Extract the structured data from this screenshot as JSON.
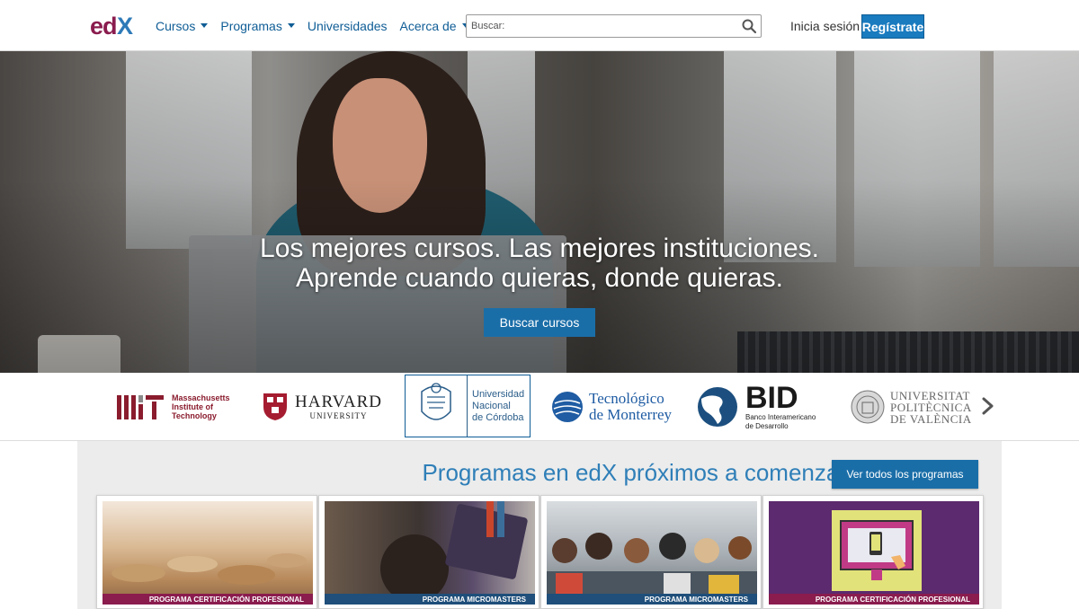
{
  "header": {
    "logo_text": "edX",
    "nav": [
      {
        "label": "Cursos",
        "has_caret": true
      },
      {
        "label": "Programas",
        "has_caret": true
      },
      {
        "label": "Universidades",
        "has_caret": false
      },
      {
        "label": "Acerca de",
        "has_caret": true
      }
    ],
    "search_placeholder": "Buscar:",
    "signin_label": "Inicia sesión",
    "register_label": "Regístrate"
  },
  "hero": {
    "title_line1": "Los mejores cursos. Las mejores instituciones.",
    "title_line2": "Aprende cuando quieras, donde quieras.",
    "cta_label": "Buscar cursos"
  },
  "partners": [
    {
      "name": "Massachusetts Institute of Technology",
      "lines": [
        "Massachusetts",
        "Institute of",
        "Technology"
      ]
    },
    {
      "name": "Harvard University",
      "lines": [
        "HARVARD",
        "UNIVERSITY"
      ]
    },
    {
      "name": "Universidad Nacional de Córdoba",
      "lines": [
        "Universidad",
        "Nacional",
        "de Córdoba"
      ]
    },
    {
      "name": "Tecnológico de Monterrey",
      "lines": [
        "Tecnológico",
        "de Monterrey"
      ]
    },
    {
      "name": "BID",
      "lines": [
        "BID",
        "Banco Interamericano",
        "de Desarrollo"
      ]
    },
    {
      "name": "Universitat Politècnica de València",
      "lines": [
        "UNIVERSITAT",
        "POLITÈCNICA",
        "DE VALÈNCIA"
      ]
    }
  ],
  "programs": {
    "title": "Programas en edX próximos a comenzar",
    "view_all_label": "Ver todos los programas",
    "cards": [
      {
        "tag": "PROGRAMA CERTIFICACIÓN PROFESIONAL",
        "tag_color": "#8a1c4e"
      },
      {
        "tag": "PROGRAMA MICROMASTERS",
        "tag_color": "#1f4f7a"
      },
      {
        "tag": "PROGRAMA MICROMASTERS",
        "tag_color": "#1f4f7a"
      },
      {
        "tag": "PROGRAMA CERTIFICACIÓN PROFESIONAL",
        "tag_color": "#8a1c4e"
      }
    ]
  },
  "colors": {
    "brand_blue": "#0f5d96",
    "button_blue": "#1a6ea8",
    "logo_magenta": "#8a1c4e",
    "logo_blue": "#2e7ab8"
  },
  "icons": [
    "search-icon",
    "chevron-right-icon",
    "caret-down-icon"
  ]
}
